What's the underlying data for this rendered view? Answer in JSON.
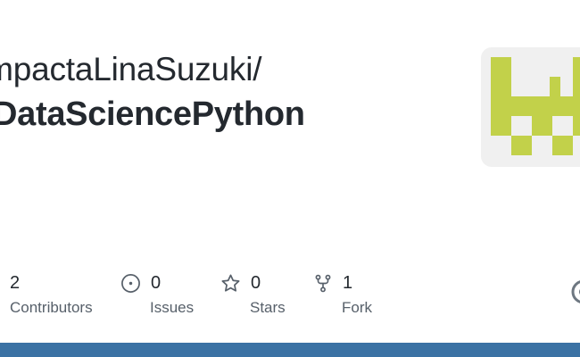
{
  "repo_card": {
    "owner": "ImpactaLinaSuzuki/",
    "name": "DataSciencePython"
  },
  "stats": {
    "contributors": {
      "value": "2",
      "label": "Contributors",
      "icon": "people-icon"
    },
    "issues": {
      "value": "0",
      "label": "Issues",
      "icon": "issue-opened-icon"
    },
    "stars": {
      "value": "0",
      "label": "Stars",
      "icon": "star-icon"
    },
    "forks": {
      "value": "1",
      "label": "Fork",
      "icon": "repo-forked-icon"
    }
  },
  "colors": {
    "identicon": "#c2d14a",
    "identicon_bg": "#f0f0f0",
    "bottom_bar": "#3b72a4",
    "text_primary": "#24292f",
    "text_secondary": "#57606a"
  }
}
